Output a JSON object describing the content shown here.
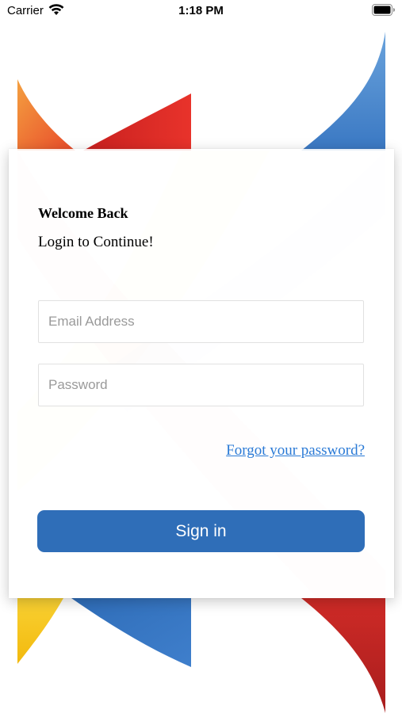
{
  "status_bar": {
    "carrier": "Carrier",
    "time": "1:18 PM",
    "wifi_icon": "wifi-icon",
    "battery_icon": "battery-icon"
  },
  "login": {
    "title": "Welcome Back",
    "subtitle": "Login to Continue!",
    "email_placeholder": "Email Address",
    "email_value": "",
    "password_placeholder": "Password",
    "password_value": "",
    "forgot_password": "Forgot your password?",
    "sign_in": "Sign in"
  },
  "colors": {
    "primary_button": "#2f6eb8",
    "link": "#2a7ad6",
    "ribbon_blue": "#3a78c3",
    "ribbon_red": "#d12a26",
    "ribbon_orange": "#f07c2c",
    "ribbon_yellow": "#f7c815"
  }
}
